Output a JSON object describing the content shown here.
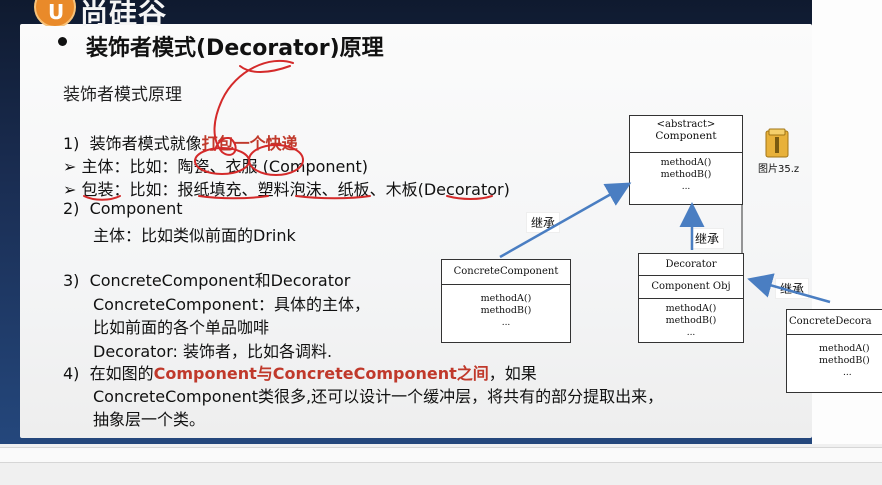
{
  "brand": {
    "logo_letter": "U",
    "name": "尚硅谷"
  },
  "slide": {
    "title": "装饰者模式(Decorator)原理",
    "subtitle": "装饰者模式原理",
    "lines": {
      "l1": {
        "num": "1)",
        "pre": "装饰者模式就像",
        "red": "打包一个快递"
      },
      "l2": {
        "arrow": "➢",
        "pre": "主体：比如：",
        "a": "陶瓷",
        "sep": "、",
        "b": "衣服",
        "post": " (Component)"
      },
      "l3": {
        "arrow": "➢",
        "a": "包装",
        "mid": "：比如：",
        "b": "报纸填充",
        "c": "、",
        "d": "塑料泡沫",
        "e": "、纸板、",
        "f": "木板",
        "post": "(Decorator)"
      },
      "l4": {
        "num": "2)",
        "text": "Component"
      },
      "l5": {
        "text": "主体：比如类似前面的Drink"
      },
      "l6": {
        "num": "3)",
        "text": "ConcreteComponent和Decorator"
      },
      "l7": {
        "text": "ConcreteComponent：具体的主体，"
      },
      "l8": {
        "text": "比如前面的各个单品咖啡"
      },
      "l9": {
        "text": "Decorator: 装饰者，比如各调料."
      },
      "l10": {
        "num": "4)",
        "pre": "在如图的",
        "red1": "Component",
        "mid": "与",
        "red2": "ConcreteComponent",
        "red3": "之间",
        "post": "，如果"
      },
      "l11": {
        "text": "ConcreteComponent类很多,还可以设计一个缓冲层，将共有的部分提取出来，"
      },
      "l12": {
        "text": "抽象层一个类。"
      }
    }
  },
  "uml": {
    "component": {
      "stereotype": "<abstract>",
      "name": "Component",
      "ops": [
        "methodA()",
        "methodB()"
      ],
      "dots": "..."
    },
    "concrete": {
      "name": "ConcreteComponent",
      "ops": [
        "methodA()",
        "methodB()"
      ],
      "dots": "..."
    },
    "decorator": {
      "name": "Decorator",
      "field": "Component Obj",
      "ops": [
        "methodA()",
        "methodB()"
      ],
      "dots": "..."
    },
    "concrete_decorator": {
      "name": "ConcreteDecora",
      "ops": [
        "methodA()",
        "methodB()"
      ],
      "dots": "..."
    },
    "inherit_label": "继承"
  },
  "desktop": {
    "file_label": "图片35.z"
  },
  "colors": {
    "accent_red": "#c0392b",
    "arrow_blue": "#4a7ec2",
    "annotation_red": "#d42a2a"
  }
}
